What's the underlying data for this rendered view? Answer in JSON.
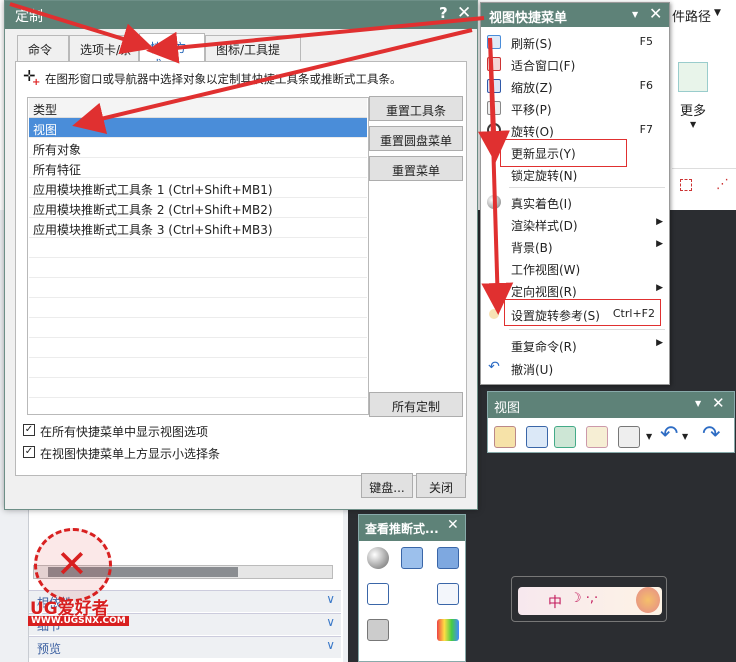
{
  "background": {
    "right_top_text": "件路径",
    "ribbon_more": "更多",
    "panel_items": [
      "相依性",
      "细节",
      "预览"
    ]
  },
  "dialog": {
    "title": "定制",
    "help": "?",
    "close": "✕",
    "tabs": [
      "命令",
      "选项卡/条",
      "快捷方式",
      "图标/工具提示"
    ],
    "active_tab": 2,
    "hint": "在图形窗口或导航器中选择对象以定制其快捷工具条或推断式工具条。",
    "list_header": "类型",
    "items": [
      "视图",
      "所有对象",
      "所有特征",
      "应用模块推断式工具条 1 (Ctrl+Shift+MB1)",
      "应用模块推断式工具条 2 (Ctrl+Shift+MB2)",
      "应用模块推断式工具条 3 (Ctrl+Shift+MB3)"
    ],
    "selected_item": 0,
    "buttons": {
      "reset_toolbar": "重置工具条",
      "reset_radial": "重置圆盘菜单",
      "reset_menu": "重置菜单",
      "all_custom": "所有定制",
      "keyboard": "键盘...",
      "close": "关闭"
    },
    "checkboxes": [
      {
        "label": "在所有快捷菜单中显示视图选项",
        "checked": true
      },
      {
        "label": "在视图快捷菜单上方显示小选择条",
        "checked": true
      }
    ]
  },
  "context_menu": {
    "title": "视图快捷菜单",
    "items": [
      {
        "label": "刷新(S)",
        "shortcut": "F5",
        "icon": "refresh-icon"
      },
      {
        "label": "适合窗口(F)",
        "shortcut": "",
        "icon": "fit-icon"
      },
      {
        "label": "缩放(Z)",
        "shortcut": "F6",
        "icon": "zoom-icon"
      },
      {
        "label": "平移(P)",
        "shortcut": "",
        "icon": "pan-icon"
      },
      {
        "label": "旋转(O)",
        "shortcut": "F7",
        "icon": "rotate-icon"
      },
      {
        "label": "更新显示(Y)",
        "shortcut": "",
        "icon": ""
      },
      {
        "label": "锁定旋转(N)",
        "shortcut": "",
        "icon": ""
      },
      {
        "label": "真实着色(I)",
        "shortcut": "",
        "icon": "shading-icon"
      },
      {
        "label": "渲染样式(D)",
        "shortcut": "",
        "icon": ""
      },
      {
        "label": "背景(B)",
        "shortcut": "",
        "icon": ""
      },
      {
        "label": "工作视图(W)",
        "shortcut": "",
        "icon": ""
      },
      {
        "label": "定向视图(R)",
        "shortcut": "",
        "icon": ""
      },
      {
        "label": "设置旋转参考(S)",
        "shortcut": "Ctrl+F2",
        "icon": "rotate-ref-icon"
      },
      {
        "label": "重复命令(R)",
        "shortcut": "",
        "icon": ""
      },
      {
        "label": "撤消(U)",
        "shortcut": "",
        "icon": "undo-icon"
      }
    ]
  },
  "view_toolbar": {
    "title": "视图"
  },
  "infer_toolbar": {
    "title": "查看推断式..."
  },
  "watermark": {
    "brand": "UG爱好者",
    "url": "WWW.UGSNX.COM"
  },
  "music_widget": {
    "text": "中"
  },
  "colors": {
    "title_bar": "#5e8278",
    "selection": "#4a8dd9",
    "annotation": "#e03030"
  }
}
